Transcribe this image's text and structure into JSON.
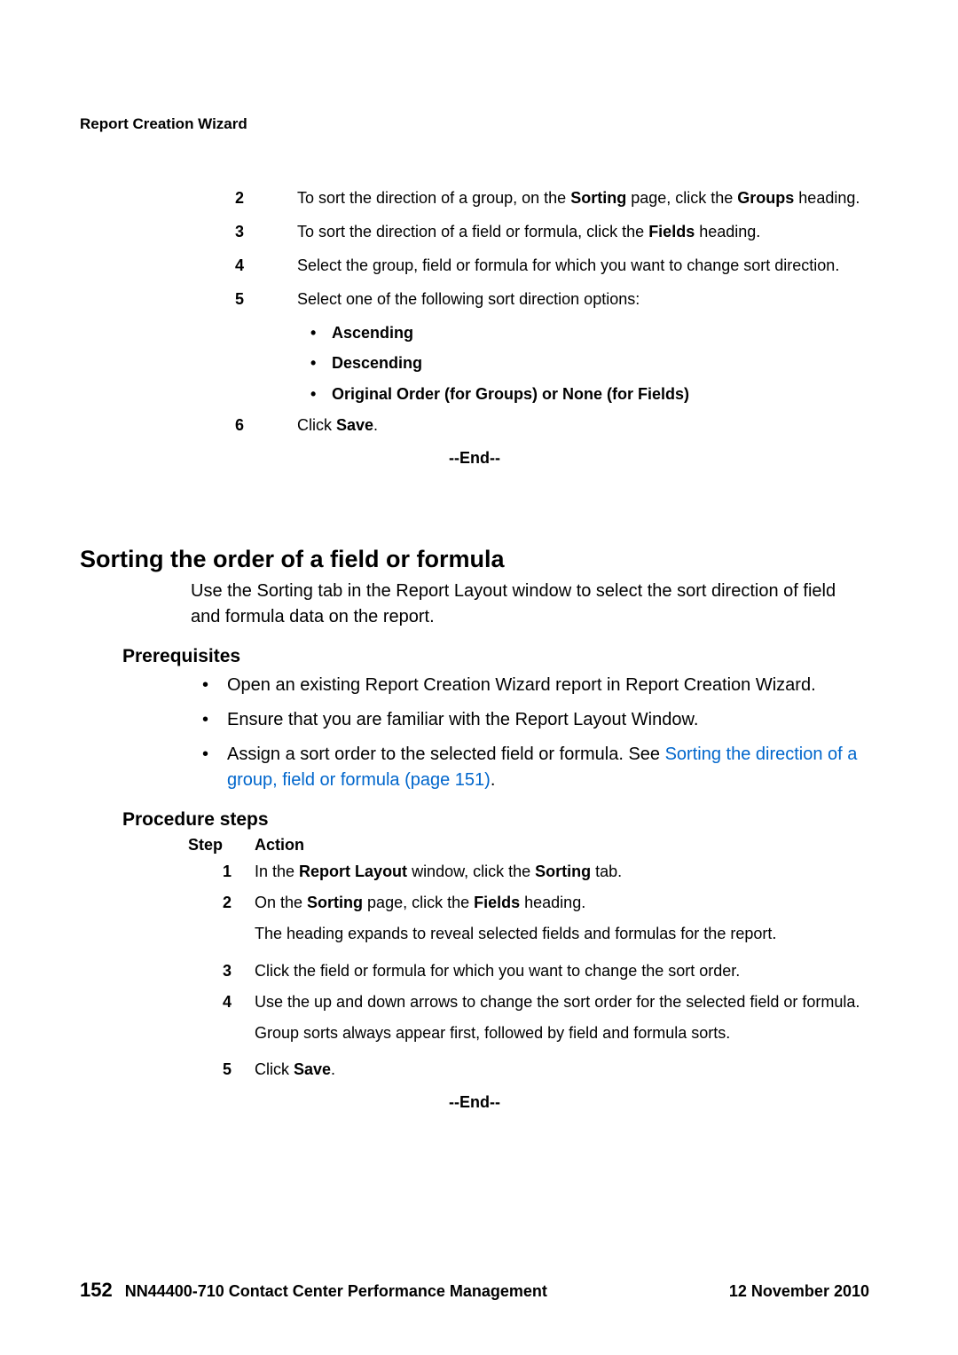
{
  "breadcrumb": "Report Creation Wizard",
  "topSteps": {
    "items": [
      {
        "num": "2",
        "segments": [
          {
            "t": "To sort the direction of a group, on the "
          },
          {
            "t": "Sorting",
            "b": true
          },
          {
            "t": " page, click the "
          },
          {
            "t": "Groups",
            "b": true
          },
          {
            "t": " heading."
          }
        ]
      },
      {
        "num": "3",
        "segments": [
          {
            "t": "To sort the direction of a field or formula, click the "
          },
          {
            "t": "Fields",
            "b": true
          },
          {
            "t": " heading."
          }
        ]
      },
      {
        "num": "4",
        "segments": [
          {
            "t": "Select the group, field or formula for which you want to change sort direction."
          }
        ]
      },
      {
        "num": "5",
        "segments": [
          {
            "t": "Select one of the following sort direction options:"
          }
        ],
        "bullets": [
          [
            {
              "t": "Ascending",
              "b": true
            }
          ],
          [
            {
              "t": "Descending",
              "b": true
            }
          ],
          [
            {
              "t": "Original Order (for Groups) or None (for Fields)",
              "b": true
            }
          ]
        ]
      },
      {
        "num": "6",
        "segments": [
          {
            "t": "Click "
          },
          {
            "t": "Save",
            "b": true
          },
          {
            "t": "."
          }
        ]
      }
    ],
    "end": "--End--"
  },
  "section": {
    "title": "Sorting the order of a field or formula",
    "intro": "Use the Sorting tab in the Report Layout window to select the sort direction of field and formula data on the report.",
    "prereqHeading": "Prerequisites",
    "prereqs": [
      [
        {
          "t": "Open an existing Report Creation Wizard report in Report Creation Wizard."
        }
      ],
      [
        {
          "t": "Ensure that you are familiar with the Report Layout Window."
        }
      ],
      [
        {
          "t": "Assign a sort order to the selected field or formula. See "
        },
        {
          "t": "Sorting the direction of a group, field or formula (page 151)",
          "link": true
        },
        {
          "t": "."
        }
      ]
    ],
    "procHeading": "Procedure steps",
    "stepLabel": "Step",
    "actionLabel": "Action",
    "steps": [
      {
        "num": "1",
        "lines": [
          [
            {
              "t": "In the "
            },
            {
              "t": "Report Layout",
              "b": true
            },
            {
              "t": " window, click the "
            },
            {
              "t": "Sorting",
              "b": true
            },
            {
              "t": " tab."
            }
          ]
        ]
      },
      {
        "num": "2",
        "lines": [
          [
            {
              "t": "On the "
            },
            {
              "t": "Sorting",
              "b": true
            },
            {
              "t": " page, click the "
            },
            {
              "t": "Fields",
              "b": true
            },
            {
              "t": " heading."
            }
          ],
          [
            {
              "t": "The heading expands to reveal selected fields and formulas for the report."
            }
          ]
        ]
      },
      {
        "num": "3",
        "lines": [
          [
            {
              "t": "Click the field or formula for which you want to change the sort order."
            }
          ]
        ]
      },
      {
        "num": "4",
        "lines": [
          [
            {
              "t": "Use the up and down arrows to change the sort order for the selected field or formula."
            }
          ],
          [
            {
              "t": "Group sorts always appear first, followed by field and formula sorts."
            }
          ]
        ]
      },
      {
        "num": "5",
        "lines": [
          [
            {
              "t": "Click "
            },
            {
              "t": "Save",
              "b": true
            },
            {
              "t": "."
            }
          ]
        ]
      }
    ],
    "end": "--End--"
  },
  "footer": {
    "pageNumber": "152",
    "docId": "NN44400-710 Contact Center Performance Management",
    "date": "12 November 2010"
  }
}
